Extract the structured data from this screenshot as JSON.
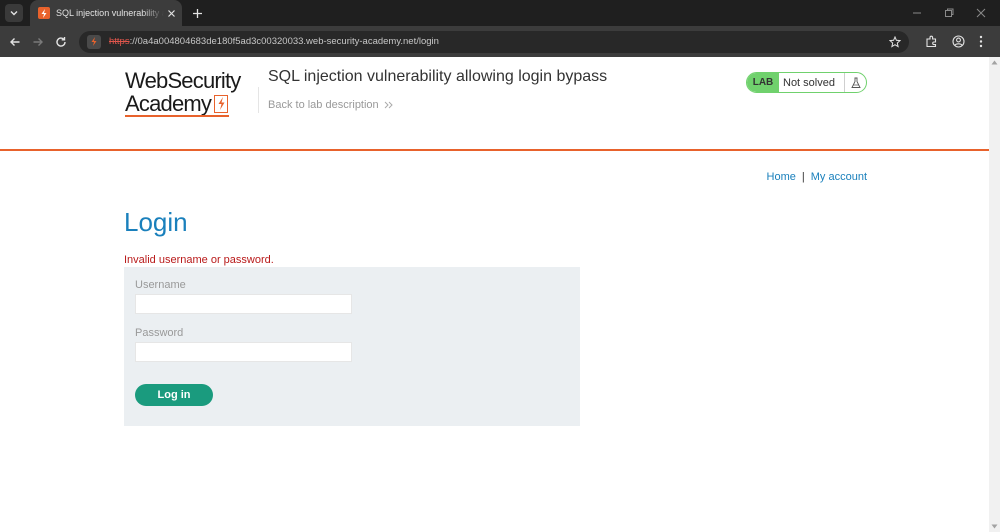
{
  "browser": {
    "tab_title": "SQL injection vulnerability allowing login bypass",
    "url_scheme": "https",
    "url_rest": "://0a4a004804683de180f5ad3c00320033.web-security-academy.net/login"
  },
  "header": {
    "logo_line1": "WebSecurity",
    "logo_line2": "Academy",
    "lab_title": "SQL injection vulnerability allowing login bypass",
    "back_link": "Back to lab description",
    "status_badge": "LAB",
    "status_text": "Not solved"
  },
  "nav": {
    "home": "Home",
    "separator": "|",
    "account": "My account"
  },
  "login": {
    "title": "Login",
    "error": "Invalid username or password.",
    "username_label": "Username",
    "username_value": "",
    "password_label": "Password",
    "password_value": "",
    "submit": "Log in"
  },
  "colors": {
    "brand_orange": "#e8622c",
    "link_blue": "#1a80bc",
    "button_teal": "#1a9b7e",
    "lab_green": "#70d16d",
    "error_red": "#b91a1a"
  }
}
